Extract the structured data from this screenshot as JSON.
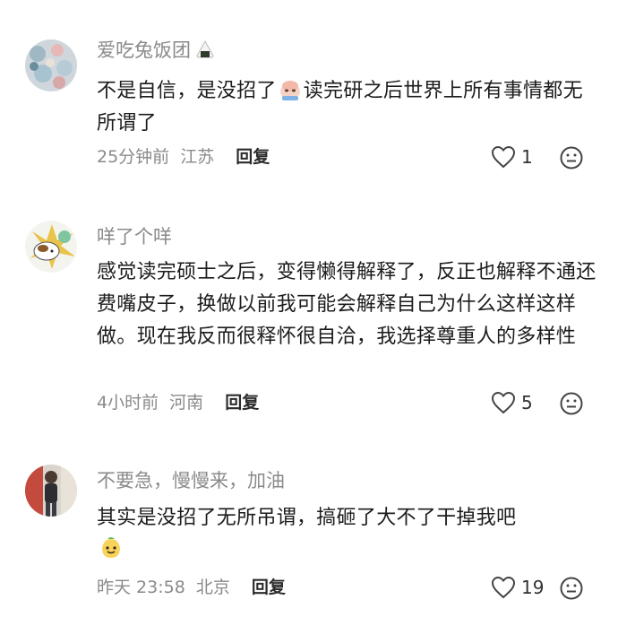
{
  "comments": [
    {
      "username": "爱吃兔饭团",
      "username_emoji": "rice-ball-icon",
      "text_before": "不是自信，是没招了",
      "text_emoji": "crying-face-icon",
      "text_after": "读完研之后世界上所有事情都无所谓了",
      "time": "25分钟前",
      "location": "江苏",
      "reply_label": "回复",
      "likes": "1"
    },
    {
      "username": "咩了个咩",
      "text": "感觉读完硕士之后，变得懒得解释了，反正也解释不通还费嘴皮子，换做以前我可能会解释自己为什么这样这样做。现在我反而很释怀很自洽，我选择尊重人的多样性",
      "time": "4小时前",
      "location": "河南",
      "reply_label": "回复",
      "likes": "5"
    },
    {
      "username": "不要急，慢慢来，加油",
      "text": "其实是没招了无所吊谓，搞砸了大不了干掉我吧",
      "text_emoji": "smile-face-icon",
      "time": "昨天 23:58",
      "location": "北京",
      "reply_label": "回复",
      "likes": "19"
    }
  ],
  "colors": {
    "meta": "#8a8a8a",
    "text": "#1c1c1c"
  }
}
